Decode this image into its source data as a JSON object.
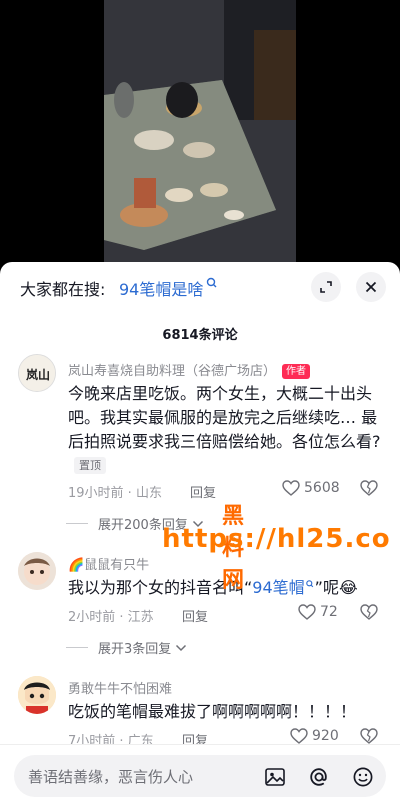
{
  "search": {
    "prefix": "大家都在搜:",
    "term": "94笔帽是啥"
  },
  "comments_header": "6814条评论",
  "comments": [
    {
      "author": "岚山寿喜烧自助料理（谷德广场店）",
      "author_badge": "作者",
      "avatar_text": "岚山",
      "text": "今晚来店里吃饭。两个女生，大概二十出头吧。我其实最佩服的是放完之后继续吃… 最后拍照说要求我三倍赔偿给她。各位怎么看?",
      "pin_label": "置顶",
      "time_location": "19小时前 · 山东",
      "reply_label": "回复",
      "likes": "5608",
      "expand_label": "展开200条回复"
    },
    {
      "author": "🌈鼠鼠有只牛",
      "text_before": "我以为那个女的抖音名叫“",
      "text_link": "94笔帽",
      "text_after": "”呢😂",
      "time_location": "2小时前 · 江苏",
      "reply_label": "回复",
      "likes": "72",
      "expand_label": "展开3条回复"
    },
    {
      "author": "勇敢牛牛不怕困难",
      "text": "吃饭的笔帽最难拔了啊啊啊啊啊！！！！",
      "time_location": "7小时前 · 广东",
      "reply_label": "回复",
      "likes": "920"
    }
  ],
  "watermark": {
    "title": "黑料网",
    "url": "https://hl25.co"
  },
  "input": {
    "placeholder": "善语结善缘，恶言伤人心"
  },
  "icons": {
    "expand": "expand-icon",
    "close": "close-icon",
    "heart": "heart-icon",
    "broken_heart": "broken-heart-icon",
    "chevron": "chevron-down-icon",
    "image": "image-icon",
    "mention": "at-icon",
    "emoji": "emoji-icon"
  },
  "colors": {
    "link": "#2c6bd1",
    "badge": "#fe2c55",
    "watermark": "#ff7a00"
  }
}
